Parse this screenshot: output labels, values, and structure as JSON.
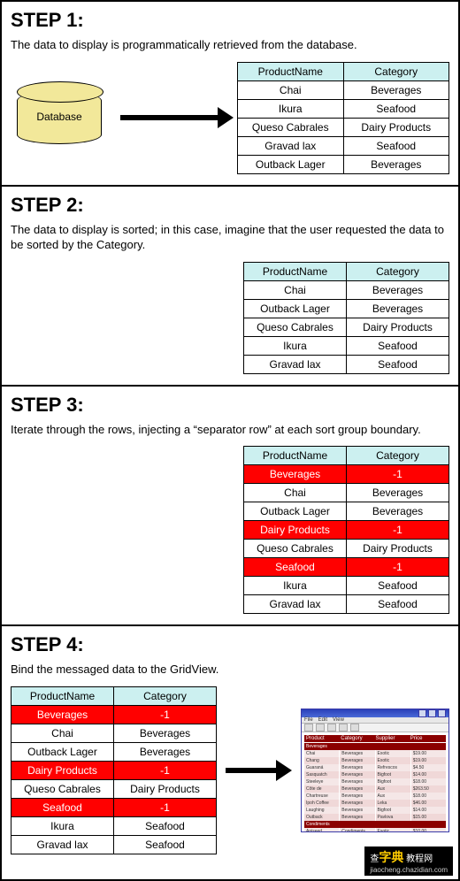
{
  "step1": {
    "title": "STEP 1:",
    "desc": "The data to display is programmatically retrieved from the database.",
    "db_label": "Database",
    "headers": {
      "a": "ProductName",
      "b": "Category"
    },
    "rows": [
      {
        "a": "Chai",
        "b": "Beverages"
      },
      {
        "a": "Ikura",
        "b": "Seafood"
      },
      {
        "a": "Queso Cabrales",
        "b": "Dairy Products"
      },
      {
        "a": "Gravad lax",
        "b": "Seafood"
      },
      {
        "a": "Outback Lager",
        "b": "Beverages"
      }
    ]
  },
  "step2": {
    "title": "STEP 2:",
    "desc": "The data to display is sorted; in this case, imagine that the user requested the data to be sorted by the Category.",
    "headers": {
      "a": "ProductName",
      "b": "Category"
    },
    "rows": [
      {
        "a": "Chai",
        "b": "Beverages"
      },
      {
        "a": "Outback Lager",
        "b": "Beverages"
      },
      {
        "a": "Queso Cabrales",
        "b": "Dairy Products"
      },
      {
        "a": "Ikura",
        "b": "Seafood"
      },
      {
        "a": "Gravad lax",
        "b": "Seafood"
      }
    ]
  },
  "step3": {
    "title": "STEP 3:",
    "desc": "Iterate through the rows, injecting a “separator row” at each sort group boundary.",
    "headers": {
      "a": "ProductName",
      "b": "Category"
    },
    "rows": [
      {
        "a": "Beverages",
        "b": "-1",
        "sep": true
      },
      {
        "a": "Chai",
        "b": "Beverages"
      },
      {
        "a": "Outback Lager",
        "b": "Beverages"
      },
      {
        "a": "Dairy Products",
        "b": "-1",
        "sep": true
      },
      {
        "a": "Queso Cabrales",
        "b": "Dairy Products"
      },
      {
        "a": "Seafood",
        "b": "-1",
        "sep": true
      },
      {
        "a": "Ikura",
        "b": "Seafood"
      },
      {
        "a": "Gravad lax",
        "b": "Seafood"
      }
    ]
  },
  "step4": {
    "title": "STEP 4:",
    "desc": "Bind the messaged data to the GridView.",
    "headers": {
      "a": "ProductName",
      "b": "Category"
    },
    "rows": [
      {
        "a": "Beverages",
        "b": "-1",
        "sep": true
      },
      {
        "a": "Chai",
        "b": "Beverages"
      },
      {
        "a": "Outback Lager",
        "b": "Beverages"
      },
      {
        "a": "Dairy Products",
        "b": "-1",
        "sep": true
      },
      {
        "a": "Queso Cabrales",
        "b": "Dairy Products"
      },
      {
        "a": "Seafood",
        "b": "-1",
        "sep": true
      },
      {
        "a": "Ikura",
        "b": "Seafood"
      },
      {
        "a": "Gravad lax",
        "b": "Seafood"
      }
    ]
  },
  "watermark": {
    "line1a": "查",
    "line1b": "字典",
    "line1c": " 教程网",
    "line2": "jiaocheng.chazidian.com"
  }
}
